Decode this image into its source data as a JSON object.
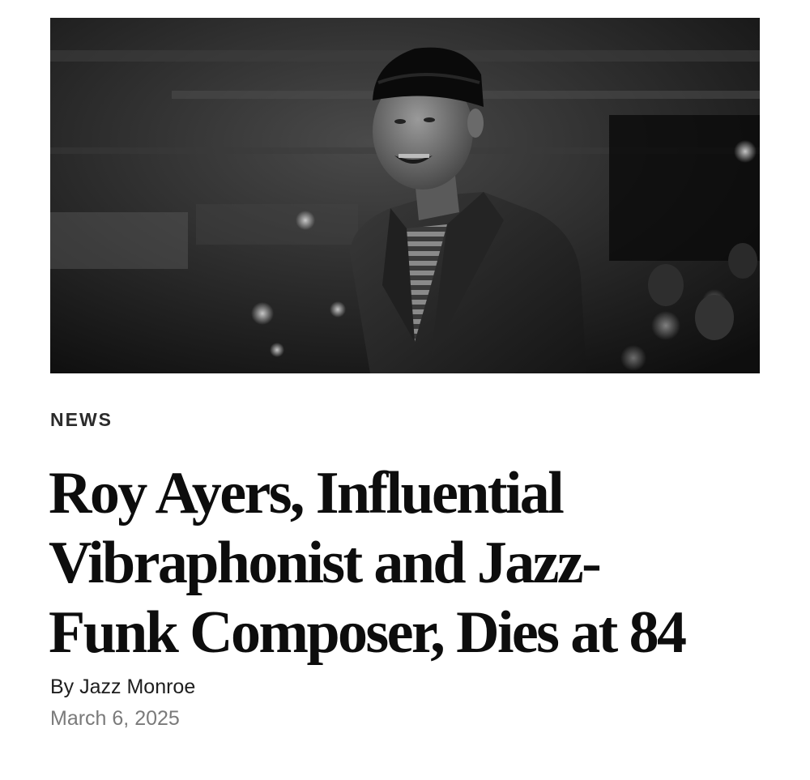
{
  "article": {
    "category": "NEWS",
    "headline_lines": [
      "Roy Ayers, Influential",
      "Vibraphonist and Jazz-",
      "Funk Composer, Dies at 84"
    ],
    "byline_prefix": "By",
    "author": "Jazz Monroe",
    "date": "March 6, 2025"
  },
  "colors": {
    "text": "#0d0d0d",
    "muted": "#7a7a7a",
    "background": "#ffffff"
  }
}
